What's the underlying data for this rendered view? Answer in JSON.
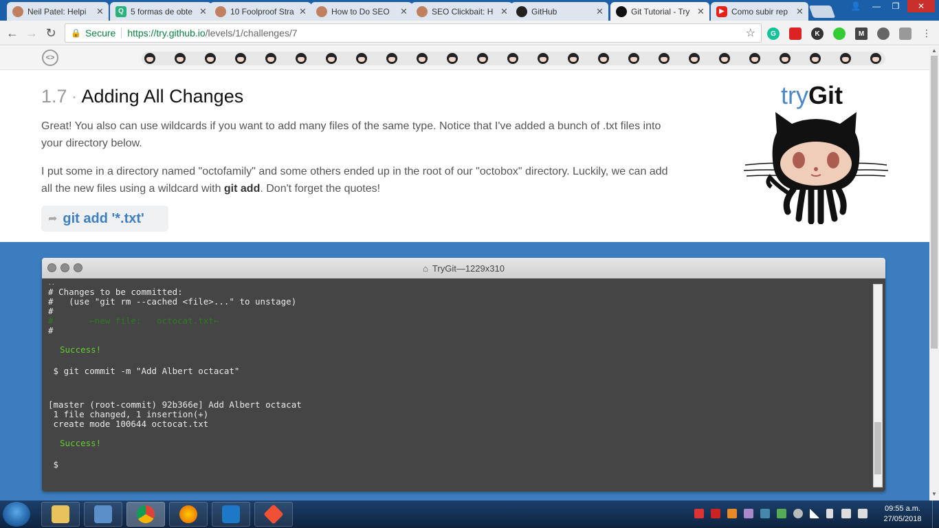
{
  "browser": {
    "tabs": [
      {
        "title": "Neil Patel: Helpi",
        "favicon": "avatar-icon"
      },
      {
        "title": "5 formas de obte",
        "favicon": "quora-icon"
      },
      {
        "title": "10 Foolproof Stra",
        "favicon": "avatar-icon"
      },
      {
        "title": "How to Do SEO",
        "favicon": "avatar-icon"
      },
      {
        "title": "SEO Clickbait: H",
        "favicon": "avatar-icon"
      },
      {
        "title": "GitHub",
        "favicon": "github-icon"
      },
      {
        "title": "Git Tutorial - Try",
        "favicon": "octocat-icon"
      },
      {
        "title": "Como subir rep",
        "favicon": "youtube-icon"
      }
    ],
    "secure_label": "Secure",
    "url_host": "https://try.github.io",
    "url_path": "/levels/1/challenges/7"
  },
  "lesson": {
    "number": "1.7",
    "separator": "·",
    "title": "Adding All Changes",
    "para1": "Great! You also can use wildcards if you want to add many files of the same type. Notice that I've added a bunch of .txt files into your directory below.",
    "para2_a": "I put some in a directory named \"octofamily\" and some others ended up in the root of our \"octobox\" directory. Luckily, we can add all the new files using a wildcard with ",
    "para2_bold": "git add",
    "para2_b": ". Don't forget the quotes!",
    "command": "git add '*.txt'"
  },
  "brand": {
    "try": "try",
    "git": "Git"
  },
  "terminal": {
    "title": "TryGit—1229x310",
    "lines": [
      "..",
      "# Changes to be committed:",
      "#   (use \"git rm --cached <file>...\" to unstage)",
      "#",
      "#       ←new file:   octocat.txt←",
      "#",
      "",
      "Success!",
      "",
      " $ git commit -m \"Add Albert octacat\"",
      "",
      "",
      "",
      "[master (root-commit) 92b366e] Add Albert octacat",
      " 1 file changed, 1 insertion(+)",
      " create mode 100644 octocat.txt",
      "",
      "Success!",
      "",
      " $"
    ]
  },
  "taskbar": {
    "time": "09:55 a.m.",
    "date": "27/05/2018"
  },
  "colors": {
    "accent": "#3b7dbf",
    "link": "#3d7fbf",
    "success": "#66cc33"
  }
}
